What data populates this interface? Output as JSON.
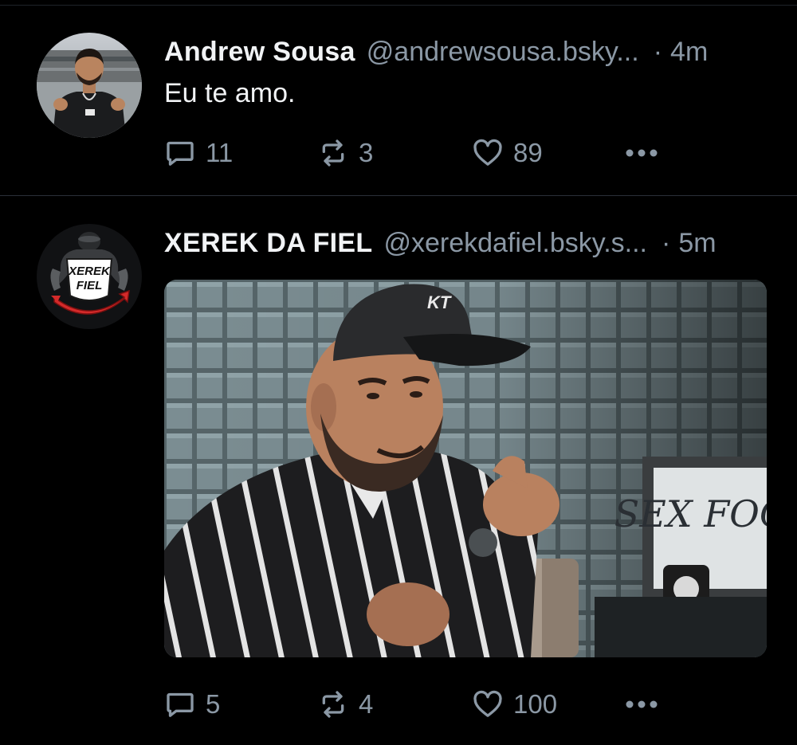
{
  "feed": {
    "posts": [
      {
        "author": {
          "display_name": "Andrew Sousa",
          "handle": "@andrewsousa.bsky...",
          "avatar_icon": "person-avatar"
        },
        "separator": "·",
        "time": "4m",
        "text": "Eu te amo.",
        "stats": {
          "replies": "11",
          "reposts": "3",
          "likes": "89"
        }
      },
      {
        "author": {
          "display_name": "XEREK DA FIEL",
          "handle": "@xerekdafiel.bsky.s...",
          "avatar_icon": "xerek-da-fiel-logo"
        },
        "separator": "·",
        "time": "5m",
        "media": {
          "type": "gif",
          "cap_text": "KT",
          "sign_text": "SEX FOOT"
        },
        "stats": {
          "replies": "5",
          "reposts": "4",
          "likes": "100"
        }
      }
    ]
  },
  "logo_text": {
    "line1": "XEREK",
    "line2": "FIEL"
  },
  "colors": {
    "background": "#000000",
    "text_primary": "#f1f3f5",
    "text_secondary": "#8b98a5",
    "divider": "#2a3038"
  }
}
